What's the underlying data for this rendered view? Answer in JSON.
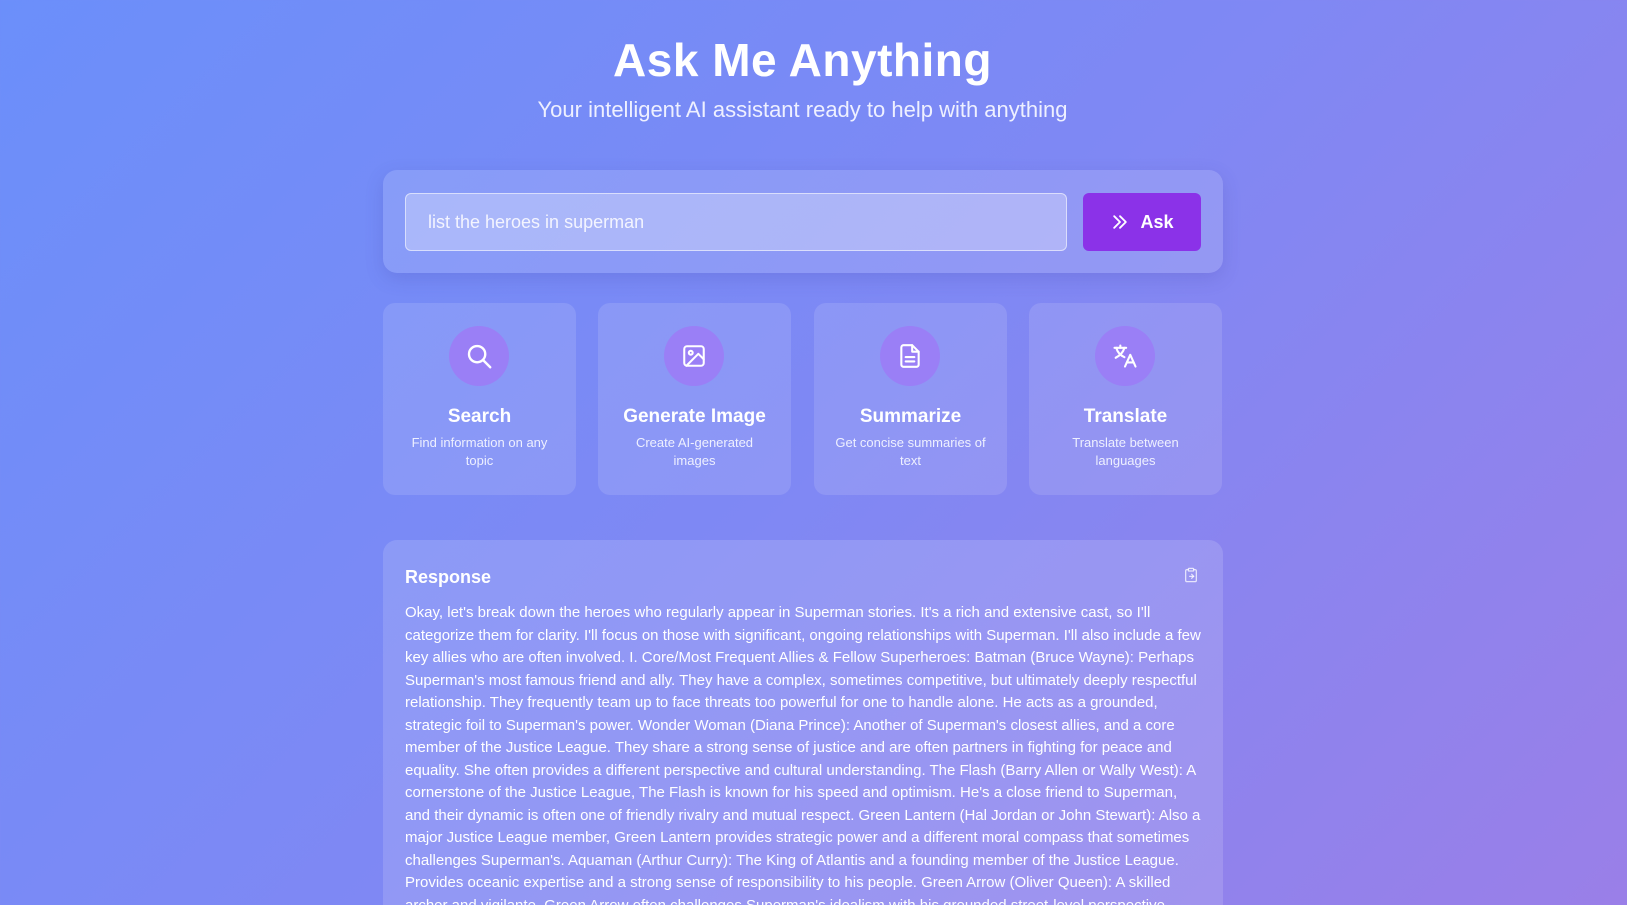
{
  "header": {
    "title": "Ask Me Anything",
    "subtitle": "Your intelligent AI assistant ready to help with anything"
  },
  "search": {
    "value": "list the heroes in superman",
    "button_label": "Ask",
    "button_icon": "double-chevron-right-icon"
  },
  "features": [
    {
      "title": "Search",
      "description": "Find information on any topic",
      "icon": "search-icon"
    },
    {
      "title": "Generate Image",
      "description": "Create AI-generated images",
      "icon": "image-icon"
    },
    {
      "title": "Summarize",
      "description": "Get concise summaries of text",
      "icon": "document-icon"
    },
    {
      "title": "Translate",
      "description": "Translate between languages",
      "icon": "translate-icon"
    }
  ],
  "response": {
    "title": "Response",
    "copy_icon": "clipboard-copy-icon",
    "text": "Okay, let's break down the heroes who regularly appear in Superman stories. It's a rich and extensive cast, so I'll categorize them for clarity. I'll focus on those with significant, ongoing relationships with Superman. I'll also include a few key allies who are often involved. I. Core/Most Frequent Allies & Fellow Superheroes: Batman (Bruce Wayne): Perhaps Superman's most famous friend and ally. They have a complex, sometimes competitive, but ultimately deeply respectful relationship. They frequently team up to face threats too powerful for one to handle alone. He acts as a grounded, strategic foil to Superman's power. Wonder Woman (Diana Prince): Another of Superman's closest allies, and a core member of the Justice League. They share a strong sense of justice and are often partners in fighting for peace and equality. She often provides a different perspective and cultural understanding. The Flash (Barry Allen or Wally West): A cornerstone of the Justice League, The Flash is known for his speed and optimism. He's a close friend to Superman, and their dynamic is often one of friendly rivalry and mutual respect. Green Lantern (Hal Jordan or John Stewart): Also a major Justice League member, Green Lantern provides strategic power and a different moral compass that sometimes challenges Superman's. Aquaman (Arthur Curry): The King of Atlantis and a founding member of the Justice League. Provides oceanic expertise and a strong sense of responsibility to his people. Green Arrow (Oliver Queen): A skilled archer and vigilante, Green Arrow often challenges Superman's idealism with his grounded street-level perspective."
  },
  "colors": {
    "accent": "#8b32e8",
    "icon_circle": "#9a7ff6"
  }
}
